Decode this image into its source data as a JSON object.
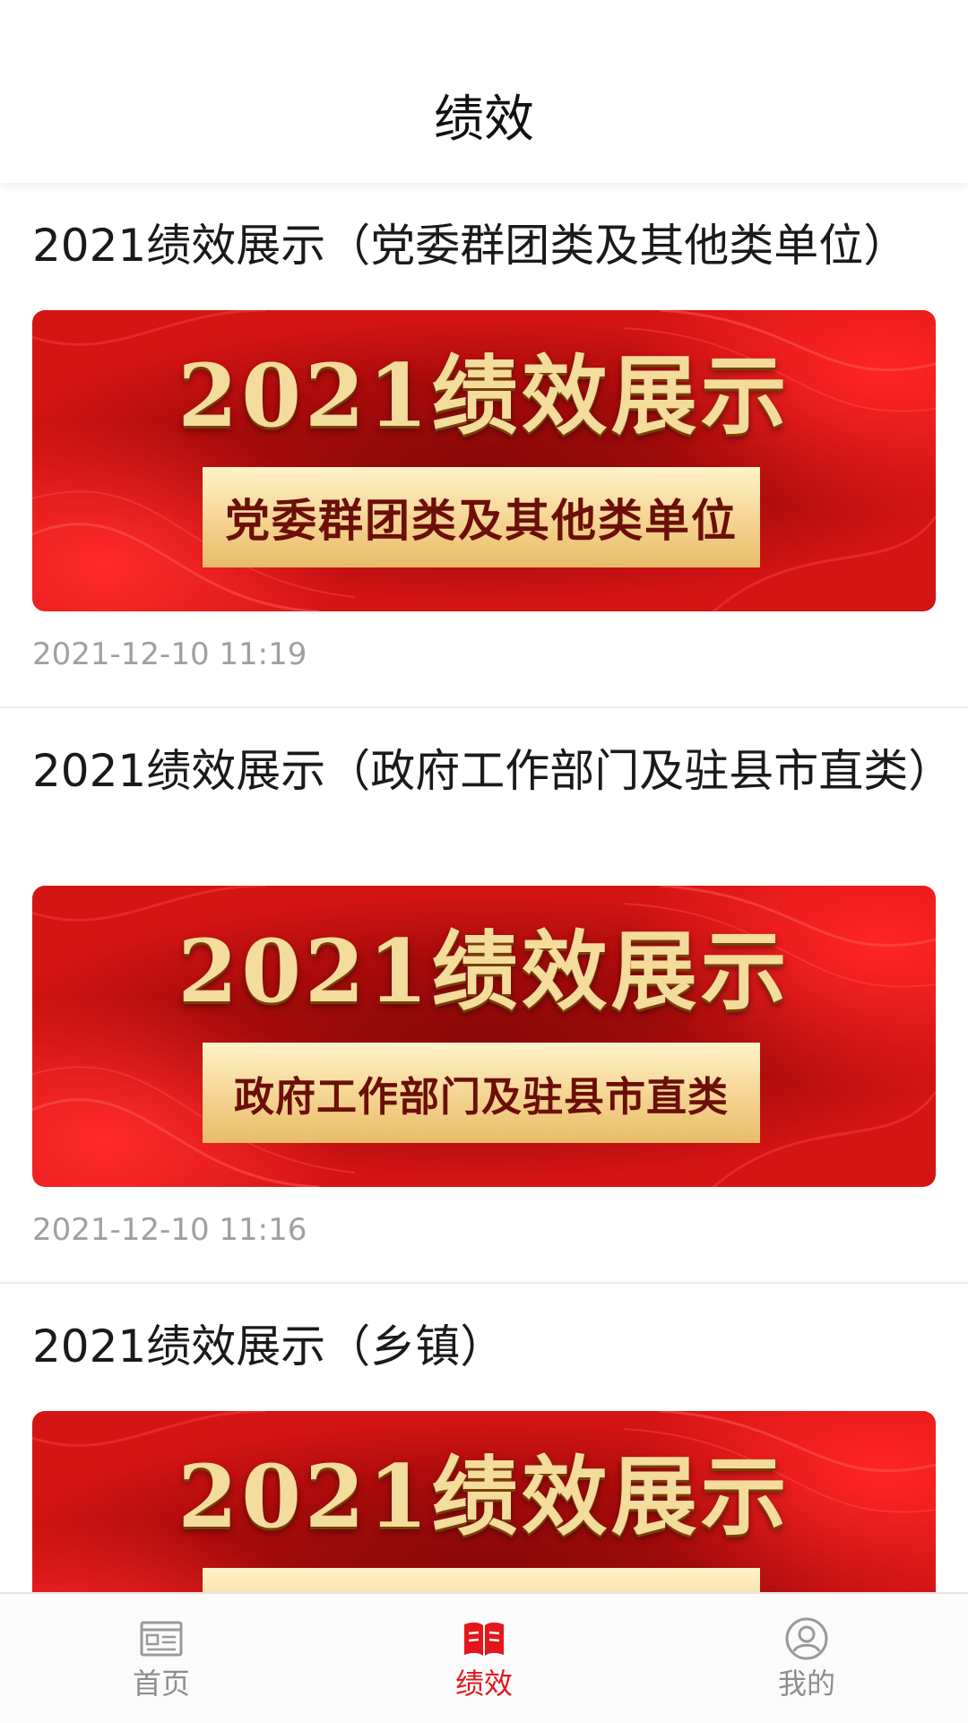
{
  "header": {
    "title": "绩效"
  },
  "articles": [
    {
      "title": "2021绩效展示（党委群团类及其他类单位）",
      "banner_headline": "2021绩效展示",
      "banner_subtitle": "党委群团类及其他类单位",
      "time": "2021-12-10 11:19"
    },
    {
      "title": "2021绩效展示（政府工作部门及驻县市直类）",
      "banner_headline": "2021绩效展示",
      "banner_subtitle": "政府工作部门及驻县市直类",
      "time": "2021-12-10 11:16"
    },
    {
      "title": "2021绩效展示（乡镇）",
      "banner_headline": "2021绩效展示",
      "banner_subtitle": ""
    }
  ],
  "tabbar": {
    "active_color": "#e4161b",
    "inactive_color": "#8e8e8e",
    "items": [
      {
        "label": "首页",
        "icon": "newspaper-icon",
        "active": false
      },
      {
        "label": "绩效",
        "icon": "open-book-icon",
        "active": true
      },
      {
        "label": "我的",
        "icon": "user-profile-icon",
        "active": false
      }
    ]
  }
}
